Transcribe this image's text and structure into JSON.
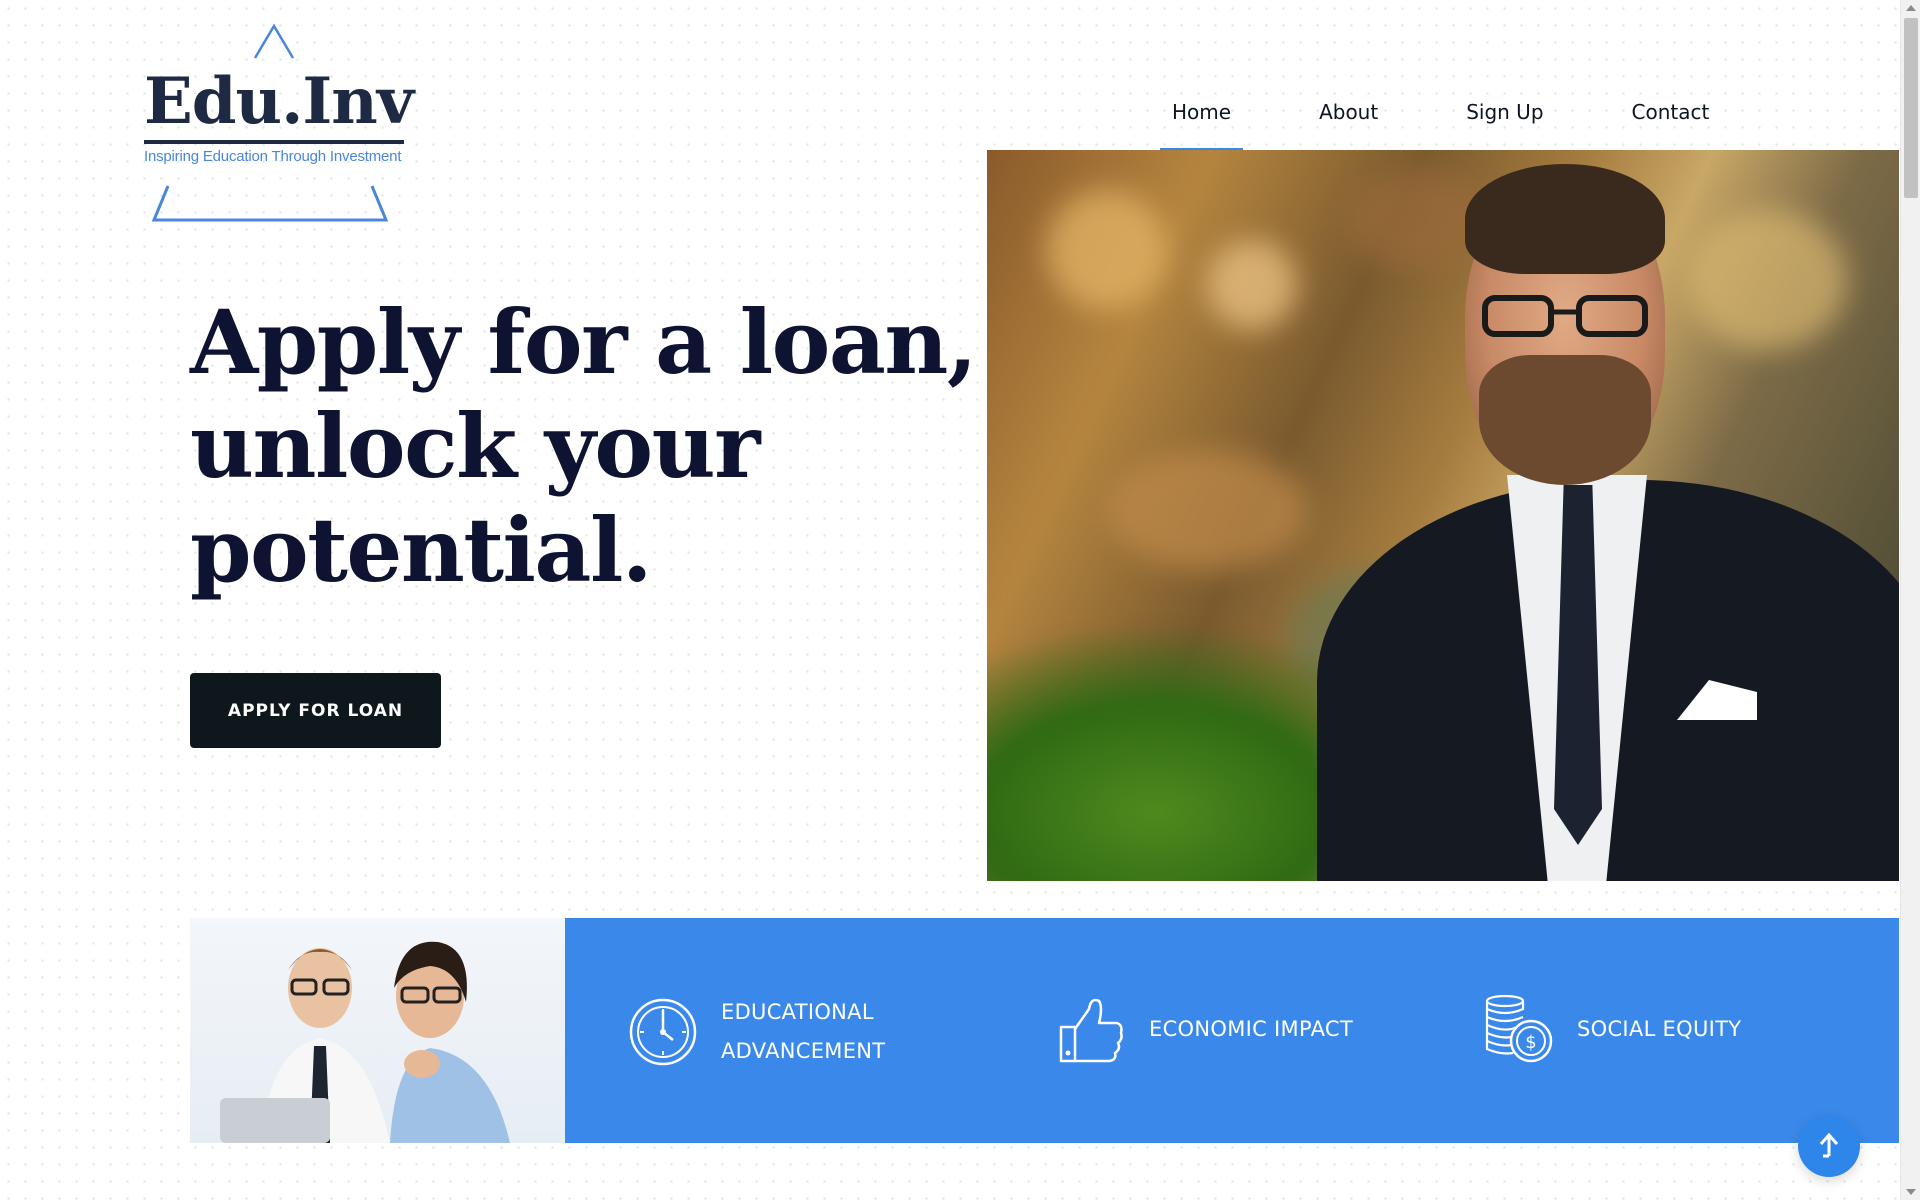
{
  "logo": {
    "name": "Edu.Inv",
    "tagline": "Inspiring Education Through Investment"
  },
  "nav": {
    "items": [
      {
        "label": "Home",
        "active": true
      },
      {
        "label": "About",
        "active": false
      },
      {
        "label": "Sign Up",
        "active": false
      },
      {
        "label": "Contact",
        "active": false
      }
    ]
  },
  "hero": {
    "title_lines": [
      "Apply for a loan,",
      "unlock your",
      "potential."
    ],
    "cta_label": "APPLY FOR LOAN",
    "image_subject": "smiling businessman in suit with glasses at cafe table",
    "slider": {
      "prev_icon": "chevron-left-icon",
      "next_icon": "chevron-right-icon"
    }
  },
  "features": {
    "photo_subject": "two smiling young professionals with glasses",
    "items": [
      {
        "icon": "clock-icon",
        "label_lines": [
          "EDUCATIONAL",
          "ADVANCEMENT"
        ]
      },
      {
        "icon": "thumbs-up-icon",
        "label_lines": [
          "ECONOMIC IMPACT"
        ]
      },
      {
        "icon": "coins-dollar-icon",
        "label_lines": [
          "SOCIAL EQUITY"
        ]
      }
    ]
  },
  "back_to_top_icon": "arrow-up-icon",
  "colors": {
    "accent": "#3a89ea",
    "dark_navy": "#0d1330",
    "button_dark": "#0e171c",
    "logo_blue": "#4a86db",
    "slider_green": "#2d7a14"
  }
}
